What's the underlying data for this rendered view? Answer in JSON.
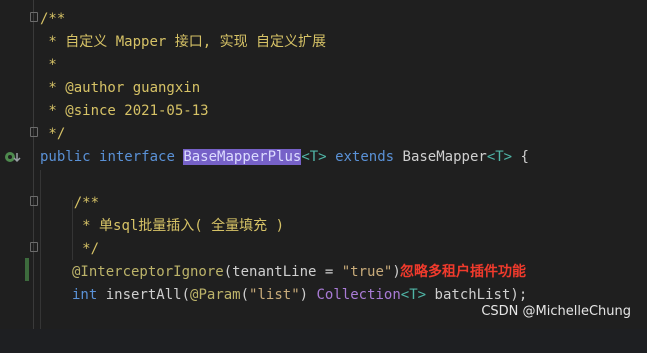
{
  "editor": {
    "lines": {
      "l1": "/**",
      "l2_prefix": " * ",
      "l2_text": "自定义 Mapper 接口, 实现 自定义扩展",
      "l3": " *",
      "l4": " * @author guangxin",
      "l5": " * @since 2021-05-13",
      "l6": " */",
      "l7": {
        "public": "public",
        "interface": "interface",
        "name": "BaseMapperPlus",
        "generic1": "<T>",
        "extends": "extends",
        "parent": "BaseMapper",
        "generic2": "<T>",
        "brace": "{"
      },
      "l9": "    /**",
      "l10_prefix": "     * ",
      "l10_text": "单sql批量插入( 全量填充 )",
      "l11": "     */",
      "l12": {
        "annotation": "@InterceptorIgnore",
        "open": "(",
        "param": "tenantLine",
        "eq": " = ",
        "value": "\"true\"",
        "close": ")",
        "note": "忽略多租户插件功能"
      },
      "l13": {
        "type": "int",
        "method": "insertAll",
        "open": "(",
        "annotation": "@Param",
        "aopen": "(",
        "string": "\"list\"",
        "aclose": ")",
        "ptype": "Collection",
        "generic": "<T>",
        "pname": "batchList",
        "end": ");"
      }
    }
  },
  "watermark": "CSDN @MichelleChung",
  "colors": {
    "background": "#1f1f1f",
    "comment": "#d6c266",
    "keyword": "#5a91d6",
    "highlight": "#7661c8",
    "annotation_note": "#f03a2c"
  },
  "icons": [
    "implemented-icon",
    "fold-marker-icon"
  ]
}
